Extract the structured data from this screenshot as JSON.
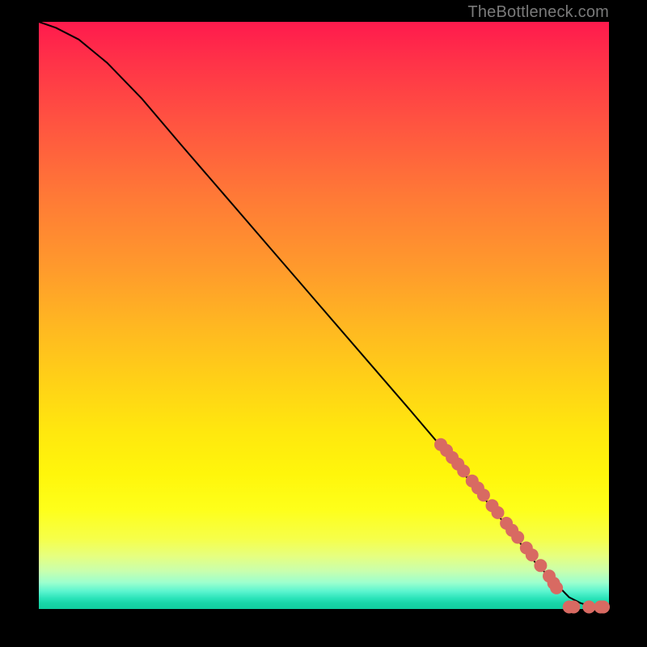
{
  "watermark": "TheBottleneck.com",
  "colors": {
    "dot": "#d86a62",
    "line": "#000000",
    "frame_bg": "#000000"
  },
  "chart_data": {
    "type": "line",
    "title": "",
    "xlabel": "",
    "ylabel": "",
    "xlim": [
      0,
      100
    ],
    "ylim": [
      0,
      100
    ],
    "grid": false,
    "legend": false,
    "series": [
      {
        "name": "curve",
        "x": [
          0,
          3,
          7,
          12,
          18,
          25,
          33,
          41,
          49,
          57,
          65,
          72,
          78,
          83,
          87,
          90,
          93,
          95,
          97,
          99,
          100
        ],
        "y": [
          100,
          99,
          97,
          93,
          87,
          79,
          70,
          61,
          52,
          43,
          34,
          26,
          19,
          13,
          8,
          5,
          2,
          1,
          0.4,
          0.2,
          0.2
        ]
      }
    ],
    "markers": {
      "name": "highlighted-points",
      "comment": "coral dots clustered on the lower-right portion of the curve and along the bottom",
      "x": [
        70.5,
        71.5,
        72.5,
        73.5,
        74.5,
        76.0,
        77.0,
        78.0,
        79.5,
        80.5,
        82.0,
        83.0,
        84.0,
        85.5,
        86.5,
        88.0,
        89.5,
        90.3,
        90.8,
        93.0,
        93.8,
        96.5,
        98.5,
        99.0
      ],
      "y": [
        28.0,
        27.0,
        25.8,
        24.7,
        23.5,
        21.8,
        20.6,
        19.4,
        17.6,
        16.4,
        14.6,
        13.4,
        12.2,
        10.4,
        9.2,
        7.4,
        5.6,
        4.4,
        3.6,
        0.35,
        0.35,
        0.35,
        0.35,
        0.35
      ]
    }
  }
}
